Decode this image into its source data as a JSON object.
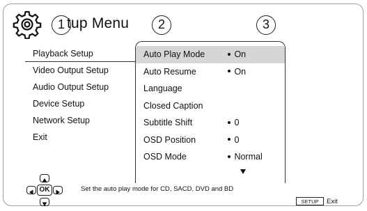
{
  "header": {
    "title": "tup Menu",
    "callouts": [
      "1",
      "2",
      "3"
    ]
  },
  "left_menu": {
    "items": [
      {
        "label": "Playback Setup",
        "selected": true
      },
      {
        "label": "Video Output Setup",
        "selected": false
      },
      {
        "label": "Audio Output Setup",
        "selected": false
      },
      {
        "label": "Device Setup",
        "selected": false
      },
      {
        "label": "Network Setup",
        "selected": false
      },
      {
        "label": "Exit",
        "selected": false
      }
    ]
  },
  "submenu": {
    "items": [
      {
        "label": "Auto Play Mode",
        "value": "On",
        "highlighted": true
      },
      {
        "label": "Auto Resume",
        "value": "On",
        "highlighted": false
      },
      {
        "label": "Language",
        "value": "",
        "highlighted": false
      },
      {
        "label": "Closed Caption",
        "value": "",
        "highlighted": false
      },
      {
        "label": "Subtitle Shift",
        "value": "0",
        "highlighted": false
      },
      {
        "label": "OSD Position",
        "value": "0",
        "highlighted": false
      },
      {
        "label": "OSD Mode",
        "value": "Normal",
        "highlighted": false
      }
    ],
    "more_icon": "triangle-down"
  },
  "footer": {
    "ok_label": "OK",
    "help_text": "Set the auto play mode for CD, SACD, DVD and BD",
    "setup_key": "SETUP",
    "exit_label": "Exit"
  },
  "colors": {
    "highlight": "#d6d6d6",
    "frame": "#a0a0a0"
  }
}
